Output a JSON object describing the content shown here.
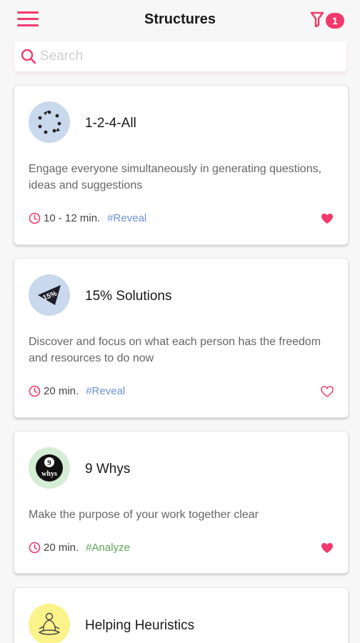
{
  "header": {
    "title": "Structures",
    "filter_count": "1"
  },
  "search": {
    "placeholder": "Search"
  },
  "colors": {
    "accent": "#f2396b",
    "reveal_tag": "#6f8fd6",
    "analyze_tag": "#5aa85a",
    "icon_blue_bg": "#c9d8ec",
    "icon_green_bg": "#d5ecd5",
    "icon_yellow_bg": "#fbf28a"
  },
  "cards": [
    {
      "title": "1-2-4-All",
      "icon": "dots-arrows-icon",
      "description": "Engage everyone simultaneously in generating questions, ideas and suggestions",
      "duration": "10 - 12 min.",
      "tag": "#Reveal",
      "favorite": true
    },
    {
      "title": "15% Solutions",
      "icon": "15-percent-pennant-icon",
      "description": "Discover and focus on what each person has the freedom and resources to do now",
      "duration": "20 min.",
      "tag": "#Reveal",
      "favorite": false
    },
    {
      "title": "9 Whys",
      "icon": "9-whys-ball-icon",
      "description": "Make the purpose of your work together clear",
      "duration": "20 min.",
      "tag": "#Analyze",
      "favorite": true
    },
    {
      "title": "Helping Heuristics",
      "icon": "meditating-figure-icon"
    }
  ]
}
